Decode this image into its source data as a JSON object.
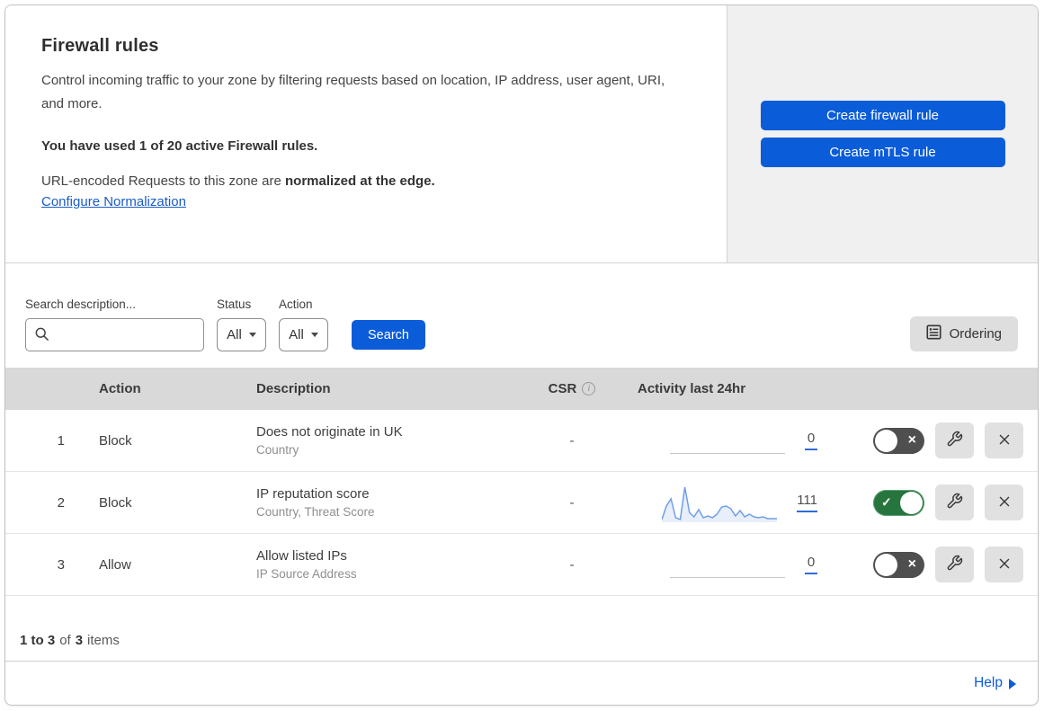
{
  "header": {
    "title": "Firewall rules",
    "description": "Control incoming traffic to your zone by filtering requests based on location, IP address, user agent, URI, and more.",
    "usage": "You have used 1 of 20 active Firewall rules.",
    "normalization_prefix": "URL-encoded Requests to this zone are ",
    "normalization_bold": "normalized at the edge.",
    "normalization_link": "Configure Normalization"
  },
  "actions_panel": {
    "create_firewall_rule_label": "Create firewall rule",
    "create_mtls_rule_label": "Create mTLS rule"
  },
  "filters": {
    "search_label": "Search description...",
    "status_label": "Status",
    "status_value": "All",
    "action_label": "Action",
    "action_value": "All",
    "search_button_label": "Search",
    "ordering_button_label": "Ordering"
  },
  "table": {
    "headers": {
      "action": "Action",
      "description": "Description",
      "csr": "CSR",
      "csr_info_glyph": "i",
      "activity": "Activity last 24hr"
    },
    "rows": [
      {
        "priority": "1",
        "action": "Block",
        "description": "Does not originate in UK",
        "criteria": "Country",
        "csr": "-",
        "activity_count": "0",
        "enabled": false,
        "sparkline": null
      },
      {
        "priority": "2",
        "action": "Block",
        "description": "IP reputation score",
        "criteria": "Country, Threat Score",
        "csr": "-",
        "activity_count": "111",
        "enabled": true,
        "sparkline": [
          41,
          26,
          18,
          39,
          41,
          5,
          33,
          38,
          30,
          39,
          37,
          39,
          35,
          27,
          26,
          29,
          37,
          31,
          38,
          35,
          38,
          39,
          38,
          40,
          40,
          40
        ]
      },
      {
        "priority": "3",
        "action": "Allow",
        "description": "Allow listed IPs",
        "criteria": "IP Source Address",
        "csr": "-",
        "activity_count": "0",
        "enabled": false,
        "sparkline": null
      }
    ]
  },
  "footer": {
    "range_bold": "1 to 3",
    "of_text": "of",
    "total_bold": "3",
    "items_text": "items",
    "help_label": "Help"
  },
  "icons": {
    "toggle_off_glyph": "×",
    "toggle_on_glyph": "✓"
  },
  "colors": {
    "accent_blue": "#0b5cd8",
    "link_blue": "#1a5bc8",
    "toggle_on_green": "#27753e",
    "toggle_off_gray": "#4f4f4f",
    "table_header_gray": "#d9d9d9",
    "panel_gray": "#f0f0f0",
    "sparkline_stroke": "#6f9fe6",
    "sparkline_fill": "#e9effa"
  }
}
